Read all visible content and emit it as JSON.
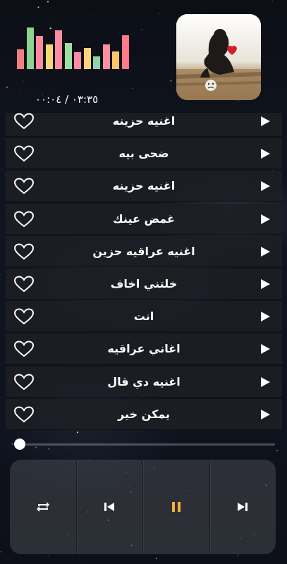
{
  "player": {
    "elapsed": "٠٠:٠٤",
    "separator": " / ",
    "duration": "٠٣:٣٥",
    "progress": 0.02,
    "state": "playing"
  },
  "equalizer": {
    "levels": [
      0.47,
      0.98,
      0.78,
      0.58,
      0.92,
      0.62,
      0.4,
      0.5,
      0.3,
      0.58,
      0.42,
      0.8
    ],
    "colors": [
      "#f08080",
      "#8fd18f",
      "#ff8aa0",
      "#f7d774",
      "#ff8ca0",
      "#9fe0a0",
      "#ff8aa6",
      "#ffd37a",
      "#8fd6a5",
      "#ff8ea0",
      "#ffc46e",
      "#ff7a8a"
    ]
  },
  "songs": [
    {
      "title": "اغنيه حزينه",
      "favorite": false
    },
    {
      "title": "ضحى بيه",
      "favorite": false
    },
    {
      "title": "اغنيه حزينه",
      "favorite": false
    },
    {
      "title": "غمض عينك",
      "favorite": false
    },
    {
      "title": "اغنيه عراقيه حزين",
      "favorite": false
    },
    {
      "title": "خلتني اخاف",
      "favorite": false
    },
    {
      "title": "انت",
      "favorite": false
    },
    {
      "title": "اغاني عراقيه",
      "favorite": false
    },
    {
      "title": "اغنيه دي قال",
      "favorite": false
    },
    {
      "title": "يمكن خير",
      "favorite": false
    }
  ],
  "controls": {
    "buttons": [
      "repeat-icon",
      "previous-icon",
      "pause-icon",
      "next-icon"
    ],
    "accent": "#f0b43a"
  },
  "colors": {
    "row_bg": "#1c1e24",
    "text": "#ffffff"
  }
}
